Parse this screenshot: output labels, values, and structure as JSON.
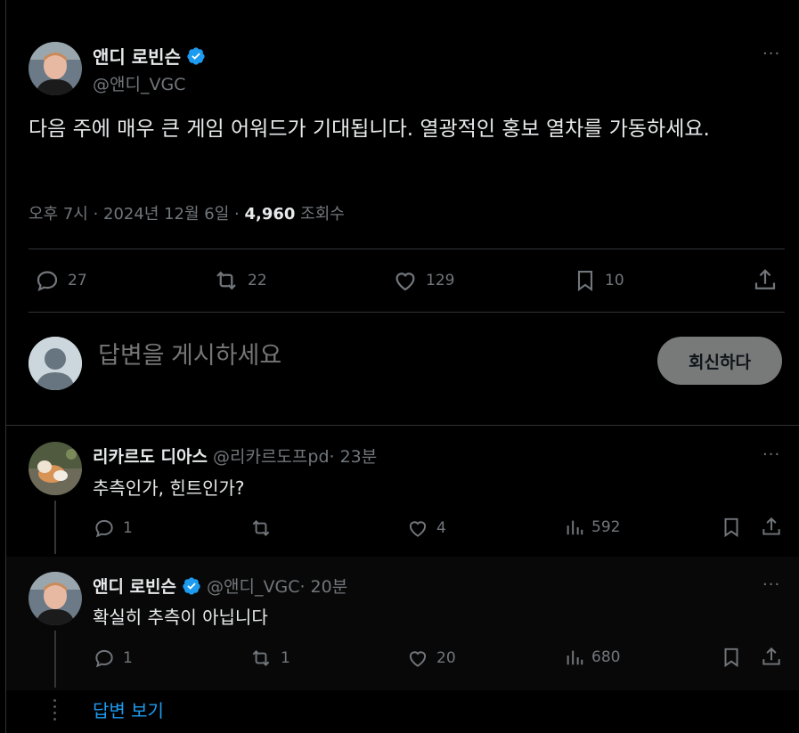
{
  "main_tweet": {
    "author_name": "앤디 로빈슨",
    "handle": "@앤디_VGC",
    "text": "다음 주에 매우 큰 게임 어워드가 기대됩니다. 열광적인 홍보 열차를 가동하세요.",
    "time": "오후 7시 · 2024년 12월 6일 · ",
    "views": "4,960",
    "views_label": " 조회수",
    "more_label": "···",
    "actions": {
      "replies": "27",
      "retweets": "22",
      "likes": "129",
      "bookmarks": "10"
    }
  },
  "composer": {
    "placeholder": "답변을 게시하세요",
    "button_label": "회신하다"
  },
  "replies": [
    {
      "name": "리카르도 디아스",
      "handle": "@리카르도프pd",
      "time": " · 23분",
      "text": "추측인가, 힌트인가?",
      "replies": "1",
      "retweets": "",
      "likes": "4",
      "views": "592"
    },
    {
      "name": "앤디 로빈슨",
      "handle": "@앤디_VGC",
      "time": " · 20분",
      "text": "확실히 추측이 아닙니다",
      "replies": "1",
      "retweets": "1",
      "likes": "20",
      "views": "680"
    }
  ],
  "show_replies": "답변 보기",
  "colors": {
    "background": "#000000",
    "text": "#e7e9ea",
    "muted": "#71767b",
    "accent": "#1d9bf0",
    "divider": "#2f3336"
  }
}
